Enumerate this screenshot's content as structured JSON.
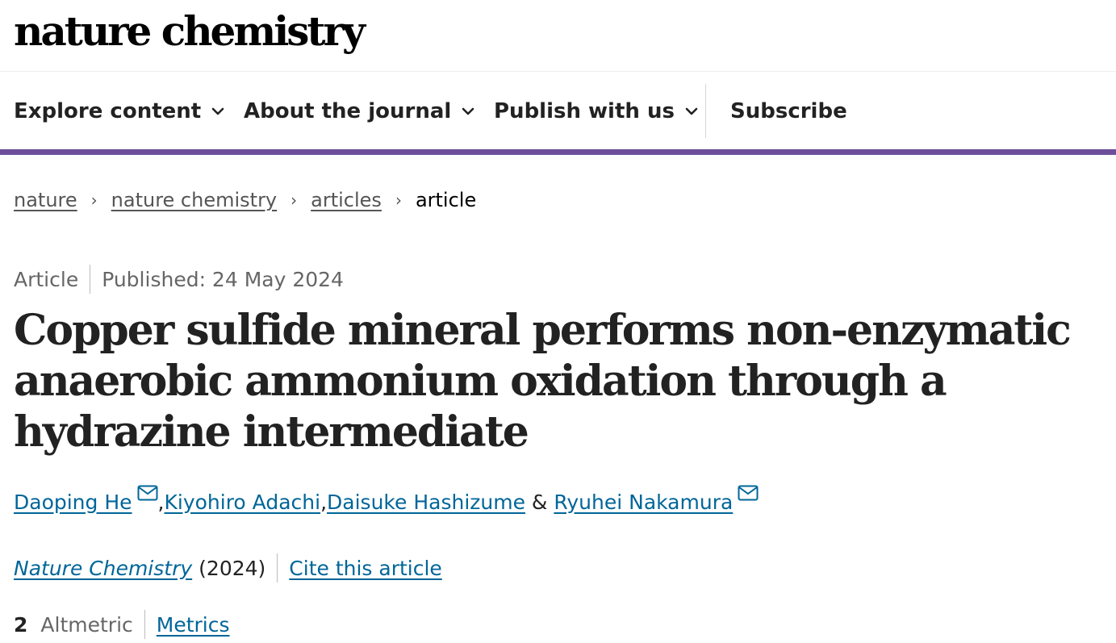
{
  "header": {
    "logo_text": "nature chemistry"
  },
  "nav": {
    "items": [
      {
        "label": "Explore content",
        "has_dropdown": true
      },
      {
        "label": "About the journal",
        "has_dropdown": true
      },
      {
        "label": "Publish with us",
        "has_dropdown": true
      },
      {
        "label": "Subscribe",
        "has_dropdown": false
      }
    ],
    "accent_color": "#6d4f9a"
  },
  "breadcrumb": {
    "items": [
      "nature",
      "nature chemistry",
      "articles"
    ],
    "current": "article"
  },
  "article": {
    "type": "Article",
    "published": "Published: 24 May 2024",
    "title": "Copper sulfide mineral performs non-enzymatic anaerobic ammonium oxidation through a hydrazine intermediate",
    "authors": [
      {
        "name": "Daoping He",
        "corresponding": true
      },
      {
        "name": "Kiyohiro Adachi",
        "corresponding": false
      },
      {
        "name": "Daisuke Hashizume",
        "corresponding": false
      },
      {
        "name": "Ryuhei Nakamura",
        "corresponding": true
      }
    ],
    "author_separators": [
      ", ",
      ", ",
      " & "
    ],
    "journal": "Nature Chemistry",
    "year": "(2024)",
    "cite_label": "Cite this article",
    "altmetric_score": "2",
    "altmetric_label": "Altmetric",
    "metrics_label": "Metrics",
    "link_color": "#006699"
  }
}
